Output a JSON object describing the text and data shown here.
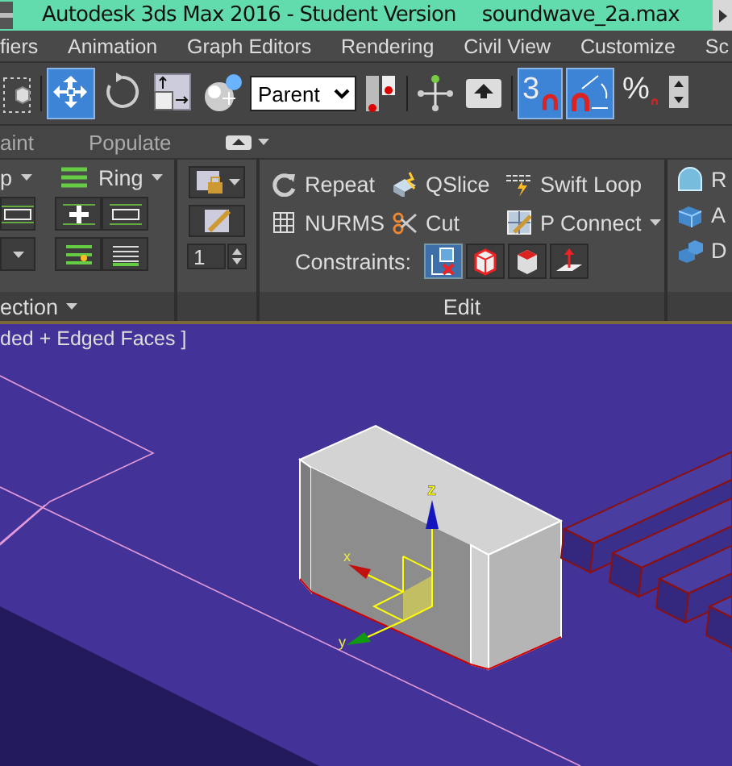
{
  "window": {
    "title": "Autodesk 3ds Max 2016 - Student Version",
    "file": "soundwave_2a.max"
  },
  "menu": [
    "fiers",
    "Animation",
    "Graph Editors",
    "Rendering",
    "Civil View",
    "Customize",
    "Sc"
  ],
  "toolbar": [
    {
      "kind": "region",
      "selected": false
    },
    {
      "kind": "move",
      "selected": true
    },
    {
      "kind": "rotate",
      "selected": false
    },
    {
      "kind": "scale",
      "selected": false
    },
    {
      "kind": "placement",
      "selected": false
    },
    {
      "kind": "dropdown",
      "value": "Parent"
    },
    {
      "kind": "pivot",
      "selected": false
    },
    {
      "kind": "center",
      "selected": false
    },
    {
      "kind": "manage",
      "selected": false
    },
    {
      "kind": "snap",
      "label": "3",
      "selected": true
    },
    {
      "kind": "angle-snap",
      "selected": true
    },
    {
      "kind": "percent-snap",
      "label": "%",
      "selected": false
    },
    {
      "kind": "spinner-snap",
      "selected": false
    }
  ],
  "ribbon_tabs": [
    "aint",
    "Populate"
  ],
  "ribbon": {
    "panels": [
      {
        "kind": "loops",
        "title": "ection",
        "title_dropdown": true,
        "commands": [
          {
            "label": "p",
            "dropdown": true
          },
          {
            "label": "Ring",
            "dropdown": true
          }
        ]
      },
      {
        "kind": "tools",
        "spinner": "1"
      },
      {
        "kind": "edit",
        "title": "Edit",
        "commands": [
          {
            "kind": "repeat",
            "label": "Repeat",
            "dropdown": false
          },
          {
            "kind": "qslice",
            "label": "QSlice",
            "dropdown": false
          },
          {
            "kind": "swift-loop",
            "label": "Swift Loop",
            "dropdown": false
          },
          {
            "kind": "nurms",
            "label": "NURMS",
            "dropdown": false
          },
          {
            "kind": "cut",
            "label": "Cut",
            "dropdown": false
          },
          {
            "kind": "p-connect",
            "label": "P Connect",
            "dropdown": true
          }
        ],
        "constraints": {
          "label": "Constraints:",
          "options": [
            {
              "kind": "none",
              "selected": true
            },
            {
              "kind": "edge",
              "selected": false
            },
            {
              "kind": "face",
              "selected": false
            },
            {
              "kind": "normal",
              "selected": false
            }
          ]
        }
      },
      {
        "kind": "geometry",
        "commands": [
          {
            "kind": "dome",
            "label": "R"
          },
          {
            "kind": "cube",
            "label": "A"
          },
          {
            "kind": "cubes",
            "label": "D"
          }
        ]
      }
    ]
  },
  "viewport": {
    "label": "ded + Edged Faces ]",
    "axis_labels": [
      "z",
      "x",
      "y"
    ]
  }
}
